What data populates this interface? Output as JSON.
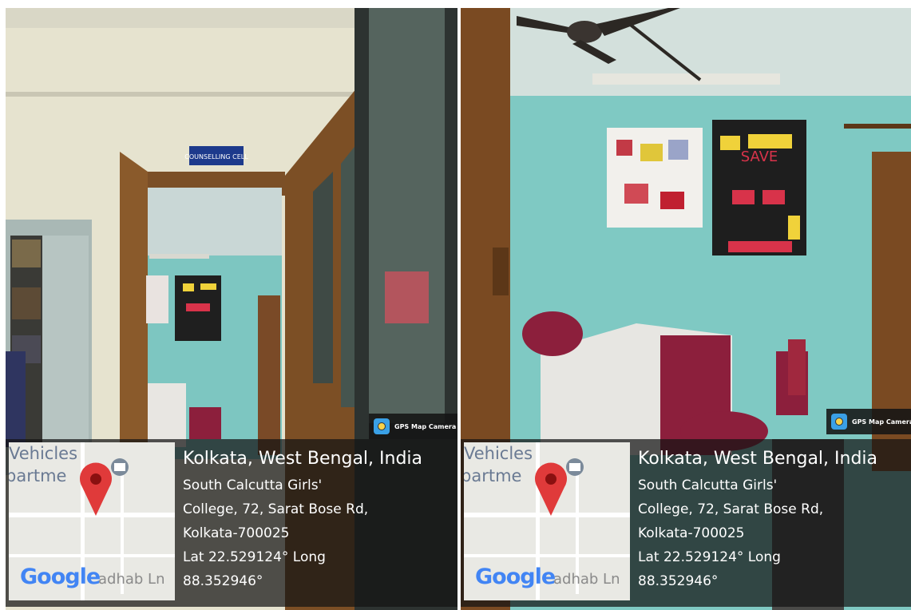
{
  "photos": [
    {
      "sign": "COUNSELLING CELL",
      "badge": "GPS Map Camera",
      "map": {
        "label_1": "Vehicles",
        "label_2": "partme",
        "road": "adhab Ln",
        "logo": "Google"
      },
      "location_title": "Kolkata, West Bengal, India",
      "address_1": "South Calcutta Girls'",
      "address_2": "College, 72, Sarat Bose Rd,",
      "address_3": "Kolkata-700025",
      "lat_line": "Lat 22.529124° Long",
      "long_line": "88.352946°"
    },
    {
      "poster_text": "SAVE",
      "badge": "GPS Map Camera",
      "map": {
        "label_1": "Vehicles",
        "label_2": "partme",
        "road": "adhab Ln",
        "logo": "Google"
      },
      "location_title": "Kolkata, West Bengal, India",
      "address_1": "South Calcutta Girls'",
      "address_2": "College, 72, Sarat Bose Rd,",
      "address_3": "Kolkata-700025",
      "lat_line": "Lat 22.529124° Long",
      "long_line": "88.352946°"
    }
  ],
  "colors": {
    "wall_cyan": "#7fc9c3",
    "wall_cream": "#e9e5cf",
    "door_brown": "#8a5a2b",
    "chair_maroon": "#8c1f3c"
  }
}
